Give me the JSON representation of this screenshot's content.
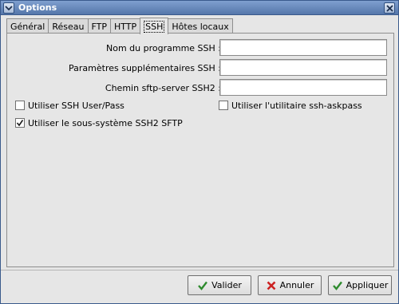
{
  "window": {
    "title": "Options"
  },
  "tabs": [
    {
      "label": "Général",
      "active": false
    },
    {
      "label": "Réseau",
      "active": false
    },
    {
      "label": "FTP",
      "active": false
    },
    {
      "label": "HTTP",
      "active": false
    },
    {
      "label": "SSH",
      "active": true
    },
    {
      "label": "Hôtes locaux",
      "active": false
    }
  ],
  "ssh": {
    "fields": [
      {
        "label": "Nom du programme SSH :",
        "value": ""
      },
      {
        "label": "Paramètres supplémentaires SSH :",
        "value": ""
      },
      {
        "label": "Chemin sftp-server SSH2 :",
        "value": ""
      }
    ],
    "checkboxes": [
      {
        "label": "Utiliser SSH User/Pass",
        "checked": false
      },
      {
        "label": "Utiliser l'utilitaire ssh-askpass",
        "checked": false
      },
      {
        "label": "Utiliser le sous-système SSH2 SFTP",
        "checked": true
      }
    ]
  },
  "buttons": {
    "ok": {
      "label": "Valider",
      "icon": "check-icon"
    },
    "cancel": {
      "label": "Annuler",
      "icon": "x-icon"
    },
    "apply": {
      "label": "Appliquer",
      "icon": "check-icon"
    }
  },
  "colors": {
    "titlebar": "#5577aa",
    "check_green": "#2e8b2e",
    "cancel_red": "#cc2222"
  }
}
